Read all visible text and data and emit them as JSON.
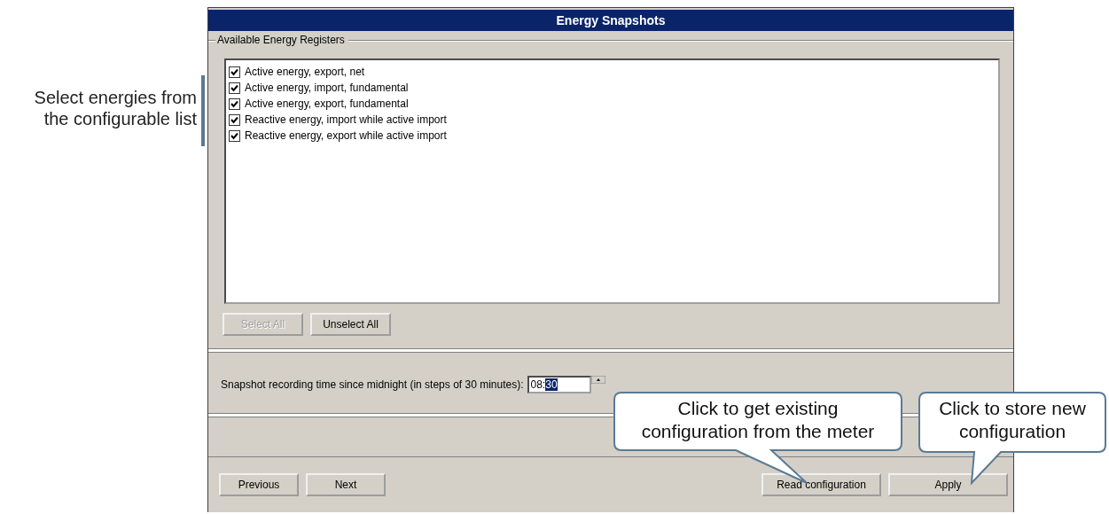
{
  "window": {
    "title": "Energy Snapshots"
  },
  "register_group": {
    "legend": "Available Energy Registers",
    "registers": [
      {
        "label": "Active energy, export, net",
        "checked": true
      },
      {
        "label": "Active energy, import, fundamental",
        "checked": true
      },
      {
        "label": "Active energy, export, fundamental",
        "checked": true
      },
      {
        "label": "Reactive energy, import while active import",
        "checked": true
      },
      {
        "label": "Reactive energy, export while active import",
        "checked": true
      }
    ],
    "buttons": [
      {
        "label": "Select All",
        "disabled": true
      },
      {
        "label": "Unselect All",
        "disabled": false
      }
    ]
  },
  "recording_time": {
    "label": "Snapshot recording time since midnight (in steps of 30 minutes):",
    "value_parts": [
      {
        "text": "08:",
        "selected": false
      },
      {
        "text": "30",
        "selected": true
      }
    ]
  },
  "nav_buttons_left": [
    {
      "label": "Previous",
      "disabled": false
    },
    {
      "label": "Next",
      "disabled": false
    }
  ],
  "nav_buttons_right": [
    {
      "label": "Read configuration",
      "disabled": false
    },
    {
      "label": "Apply",
      "disabled": false
    }
  ],
  "side_note": "Select energies from the configurable list",
  "callouts": [
    {
      "text": "Click to get existing configuration from the meter"
    },
    {
      "text": "Click to store new configuration"
    }
  ]
}
